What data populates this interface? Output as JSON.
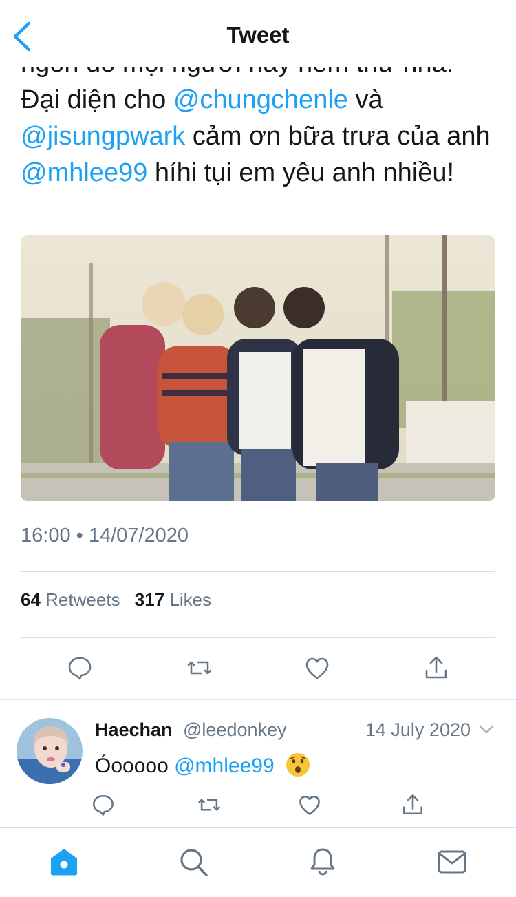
{
  "header": {
    "title": "Tweet"
  },
  "tweet": {
    "partial_line": "ngon đó mọi người hãy nếm thử nha!",
    "text_1": "Đại diện cho ",
    "mention_1": "@chungchenle",
    "text_2": " và ",
    "mention_2": "@jisungpwark",
    "text_3": " cảm ơn bữa trưa của anh ",
    "mention_3": "@mhlee99",
    "text_4": " híhi tụi em yêu anh nhiều!",
    "timestamp": "16:00 • 14/07/2020",
    "retweets_count": "64",
    "retweets_label": "Retweets",
    "likes_count": "317",
    "likes_label": "Likes"
  },
  "reply": {
    "name": "Haechan",
    "handle": "@leedonkey",
    "date": "14 July 2020",
    "text": "Óooooo ",
    "mention": "@mhlee99",
    "emoji": "astonished-face"
  },
  "colors": {
    "accent": "#1da1f2",
    "text": "#14171a",
    "muted": "#657786",
    "divider": "#d8dde1"
  },
  "icons": {
    "back": "chevron-left-icon",
    "reply": "comment-icon",
    "retweet": "retweet-icon",
    "like": "heart-icon",
    "share": "share-icon",
    "home": "home-icon",
    "search": "search-icon",
    "notifications": "bell-icon",
    "messages": "mail-icon"
  }
}
